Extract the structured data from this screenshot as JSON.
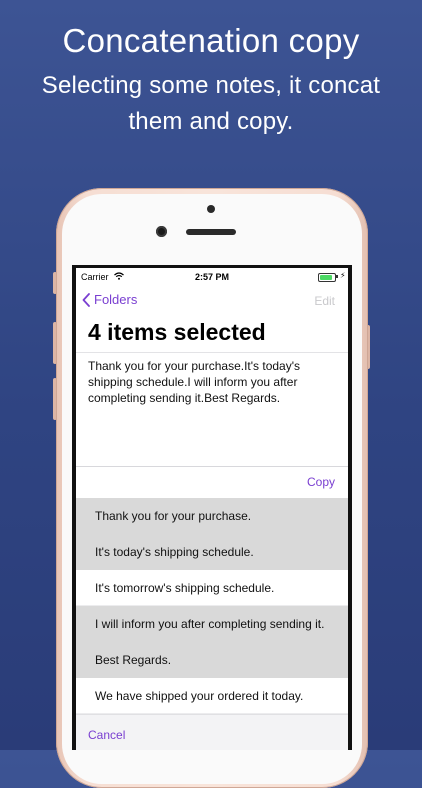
{
  "promo": {
    "headline": "Concatenation copy",
    "subline": "Selecting some notes, it concat them and copy."
  },
  "status_bar": {
    "carrier": "Carrier",
    "time": "2:57 PM",
    "battery_level": 0.85
  },
  "nav": {
    "back_label": "Folders",
    "edit_label": "Edit"
  },
  "title": "4 items selected",
  "concatenated_text": "Thank you for your purchase.It's today's shipping schedule.I will inform you after completing sending it.Best Regards.",
  "copy_label": "Copy",
  "notes": [
    {
      "text": "Thank you for your purchase.",
      "selected": true
    },
    {
      "text": "It's today's shipping schedule.",
      "selected": true
    },
    {
      "text": "It's tomorrow's shipping schedule.",
      "selected": false
    },
    {
      "text": "I will inform you after completing sending it.",
      "selected": true
    },
    {
      "text": "Best Regards.",
      "selected": true
    },
    {
      "text": "We have shipped your ordered it today.",
      "selected": false
    }
  ],
  "cancel_label": "Cancel",
  "colors": {
    "accent": "#7a3fd1",
    "background": "#31467f",
    "selected_row": "#d9d9d9"
  }
}
